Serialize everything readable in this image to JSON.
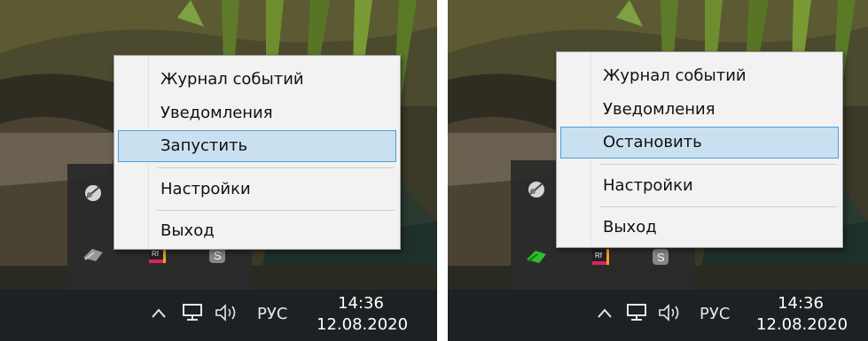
{
  "left": {
    "menu": {
      "items": [
        "Журнал событий",
        "Уведомления",
        "Запустить",
        "Настройки",
        "Выход"
      ],
      "highlighted_index": 2
    },
    "taskbar": {
      "lang": "РУС",
      "time": "14:36",
      "date": "12.08.2020"
    },
    "tray_icons": [
      "satellite-icon",
      "gray-arrow-icon",
      "app-icon",
      "s-badge-icon"
    ]
  },
  "right": {
    "menu": {
      "items": [
        "Журнал событий",
        "Уведомления",
        "Остановить",
        "Настройки",
        "Выход"
      ],
      "highlighted_index": 2
    },
    "taskbar": {
      "lang": "РУС",
      "time": "14:36",
      "date": "12.08.2020"
    },
    "tray_icons": [
      "satellite-icon",
      "green-arrow-icon",
      "app-icon",
      "s-badge-icon"
    ]
  },
  "colors": {
    "highlight_bg": "#c9e0f0",
    "highlight_border": "#4d9fd6",
    "menu_bg": "#f2f2f2",
    "taskbar": "#1c2223"
  }
}
